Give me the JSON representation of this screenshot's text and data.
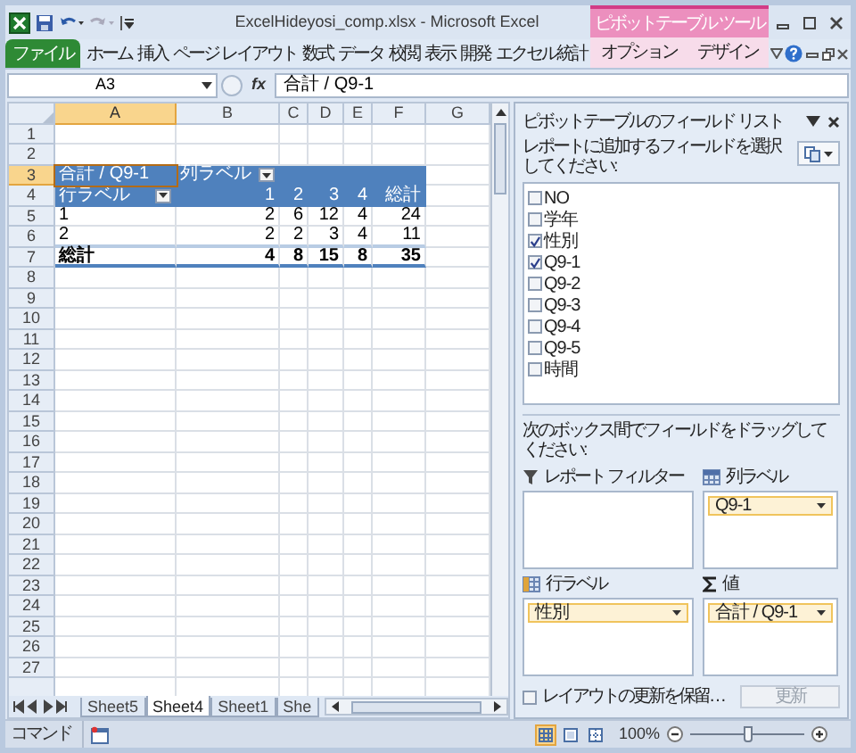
{
  "window": {
    "title": "ExcelHideyosi_comp.xlsx - Microsoft Excel",
    "context_group": "ピボットテーブル ツール"
  },
  "ribbon_tabs": [
    {
      "label": "ファイル",
      "kind": "file"
    },
    {
      "label": "ホーム",
      "kind": "main"
    },
    {
      "label": "挿入",
      "kind": "main"
    },
    {
      "label": "ページ レイアウト",
      "kind": "main"
    },
    {
      "label": "数式",
      "kind": "main"
    },
    {
      "label": "データ",
      "kind": "main"
    },
    {
      "label": "校閲",
      "kind": "main"
    },
    {
      "label": "表示",
      "kind": "main"
    },
    {
      "label": "開発",
      "kind": "main"
    },
    {
      "label": "エクセル統計",
      "kind": "main"
    },
    {
      "label": "オプション",
      "kind": "context"
    },
    {
      "label": "デザイン",
      "kind": "context"
    }
  ],
  "formula_bar": {
    "name_box": "A3",
    "function_label": "fx",
    "formula": "合計 / Q9-1"
  },
  "sheet": {
    "columns": [
      {
        "label": "A",
        "selected": true
      },
      {
        "label": "B",
        "selected": false
      },
      {
        "label": "C",
        "selected": false
      },
      {
        "label": "D",
        "selected": false
      },
      {
        "label": "E",
        "selected": false
      },
      {
        "label": "F",
        "selected": false
      },
      {
        "label": "G",
        "selected": false
      }
    ],
    "rows": [
      {
        "number": "1",
        "selected": false
      },
      {
        "number": "2",
        "selected": false
      },
      {
        "number": "3",
        "selected": true
      },
      {
        "number": "4",
        "selected": false
      },
      {
        "number": "5",
        "selected": false
      },
      {
        "number": "6",
        "selected": false
      },
      {
        "number": "7",
        "selected": false
      },
      {
        "number": "8",
        "selected": false
      },
      {
        "number": "9",
        "selected": false
      },
      {
        "number": "10",
        "selected": false
      },
      {
        "number": "11",
        "selected": false
      },
      {
        "number": "12",
        "selected": false
      },
      {
        "number": "13",
        "selected": false
      },
      {
        "number": "14",
        "selected": false
      },
      {
        "number": "15",
        "selected": false
      },
      {
        "number": "16",
        "selected": false
      },
      {
        "number": "17",
        "selected": false
      },
      {
        "number": "18",
        "selected": false
      },
      {
        "number": "19",
        "selected": false
      },
      {
        "number": "20",
        "selected": false
      },
      {
        "number": "21",
        "selected": false
      },
      {
        "number": "22",
        "selected": false
      },
      {
        "number": "23",
        "selected": false
      },
      {
        "number": "24",
        "selected": false
      },
      {
        "number": "25",
        "selected": false
      },
      {
        "number": "26",
        "selected": false
      },
      {
        "number": "27",
        "selected": false
      }
    ],
    "pivot": {
      "value_field": "合計 / Q9-1",
      "column_label": "列ラベル",
      "row_label": "行ラベル",
      "column_headers": [
        "1",
        "2",
        "3",
        "4",
        "総計"
      ],
      "rows": [
        {
          "label": "1",
          "values": [
            "2",
            "6",
            "12",
            "4",
            "24"
          ]
        },
        {
          "label": "2",
          "values": [
            "2",
            "2",
            "3",
            "4",
            "11"
          ]
        }
      ],
      "total": {
        "label": "総計",
        "values": [
          "4",
          "8",
          "15",
          "8",
          "35"
        ]
      }
    }
  },
  "sheet_tabs": [
    {
      "label": "Sheet5",
      "selected": false
    },
    {
      "label": "Sheet4",
      "selected": true
    },
    {
      "label": "Sheet1",
      "selected": false
    },
    {
      "label": "She",
      "selected": false
    }
  ],
  "field_list": {
    "title": "ピボットテーブルのフィールド リスト",
    "instruction": "レポートに追加するフィールドを選択してください:",
    "fields": [
      {
        "label": "NO",
        "checked": false
      },
      {
        "label": "学年",
        "checked": false
      },
      {
        "label": "性別",
        "checked": true
      },
      {
        "label": "Q9-1",
        "checked": true
      },
      {
        "label": "Q9-2",
        "checked": false
      },
      {
        "label": "Q9-3",
        "checked": false
      },
      {
        "label": "Q9-4",
        "checked": false
      },
      {
        "label": "Q9-5",
        "checked": false
      },
      {
        "label": "時間",
        "checked": false
      }
    ],
    "drag_instruction": "次のボックス間でフィールドをドラッグしてください:",
    "areas": [
      {
        "kind": "filter",
        "label": "レポート フィルター"
      },
      {
        "kind": "columns",
        "label": "列ラベル",
        "fields": [
          "Q9-1"
        ]
      },
      {
        "kind": "rows",
        "label": "行ラベル",
        "fields": [
          "性別"
        ]
      },
      {
        "kind": "values",
        "label": "値",
        "fields": [
          "合計 / Q9-1"
        ]
      }
    ],
    "defer_update": {
      "label": "レイアウトの更新を保留…",
      "checked": false
    },
    "update_button": {
      "label": "更新",
      "disabled": true
    }
  },
  "status_bar": {
    "mode": "コマンド",
    "views": [
      {
        "kind": "normal",
        "selected": true
      },
      {
        "kind": "page_layout",
        "selected": false
      },
      {
        "kind": "page_break",
        "selected": false
      }
    ],
    "zoom": "100%",
    "zoom_slider": {
      "level": 0.5
    }
  }
}
